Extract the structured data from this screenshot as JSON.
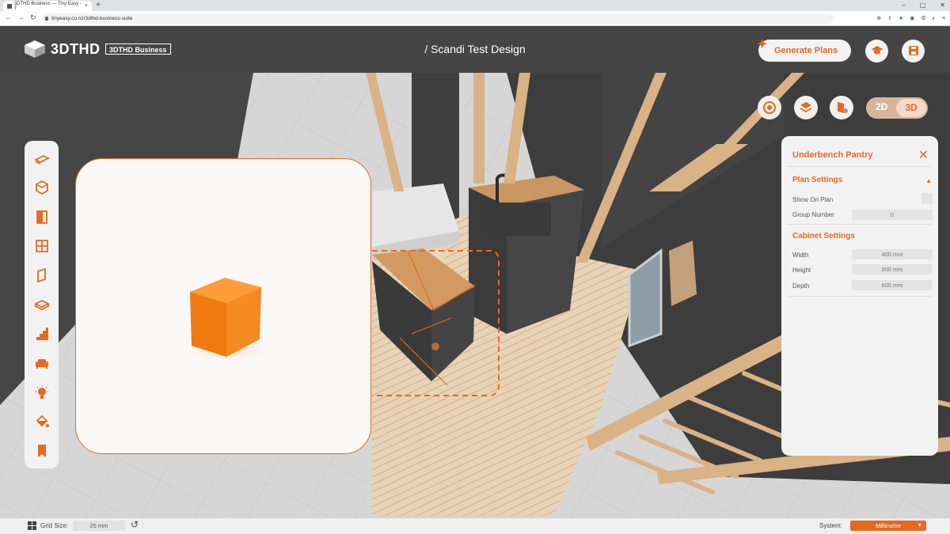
{
  "browser": {
    "tab_title": "3DTHD Business — Tiny Easy - T",
    "tab_close": "×",
    "new_tab": "+",
    "window_controls": [
      "‒",
      "▢",
      "✕"
    ],
    "nav": [
      "←",
      "→",
      "↻"
    ],
    "url": "tinyeasy.co.nz/3dthd-business-suite",
    "toolbar_icons": [
      "⊕",
      "⇧",
      "★",
      "◉",
      "⚙",
      "◐",
      "≡"
    ]
  },
  "header": {
    "logo_text": "3DTHD",
    "business_badge": "3DTHD Business",
    "title": "/ Scandi Test Design",
    "generate_button": "Generate Plans",
    "learn_icon": "graduation-cap-icon",
    "save_icon": "save-disk-icon"
  },
  "view_tools": {
    "opt_2d": "2D",
    "opt_3d": "3D",
    "active": "3D"
  },
  "palette": {
    "tools": [
      "floor",
      "wall-box",
      "door",
      "window",
      "panel",
      "layer",
      "stairs",
      "sofa",
      "light",
      "paint",
      "bookmark"
    ]
  },
  "panel": {
    "title": "Underbench Pantry",
    "close": "✕",
    "plan_settings": {
      "title": "Plan Settings",
      "caret": "▲",
      "show_on_plan_label": "Show On Plan",
      "show_on_plan": false,
      "group_number_label": "Group Number",
      "group_number": "0"
    },
    "cabinet_settings": {
      "title": "Cabinet Settings",
      "width_label": "Width",
      "width": "400 mm",
      "height_label": "Height",
      "height": "900 mm",
      "depth_label": "Depth",
      "depth": "600 mm"
    }
  },
  "status": {
    "grid_label": "Grid Size:",
    "grid_value": "25 mm",
    "reset_icon": "↺",
    "system_label": "System:",
    "system_value": "Millimetre",
    "system_caret": "▼"
  },
  "colors": {
    "accent": "#e56a1f",
    "header_bg": "#454545",
    "panel_bg": "#f2f2f2"
  }
}
